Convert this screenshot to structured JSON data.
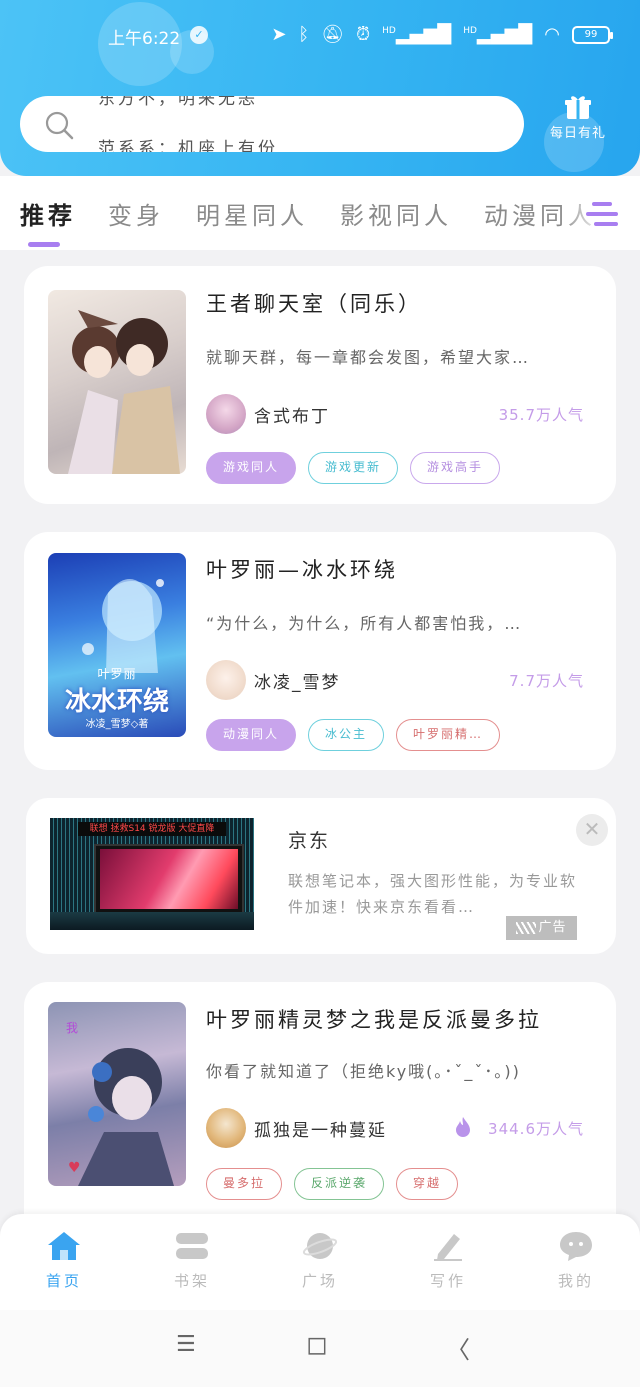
{
  "status_bar": {
    "time": "上午6:22",
    "battery": "99"
  },
  "search": {
    "hint_top": "东方不，明来无恙",
    "hint_bottom": "范系系：机座上有份"
  },
  "gift": {
    "label": "每日有礼"
  },
  "tabs": [
    {
      "label": "推荐"
    },
    {
      "label": "变身"
    },
    {
      "label": "明星同人"
    },
    {
      "label": "影视同人"
    },
    {
      "label": "动漫同人"
    }
  ],
  "books": [
    {
      "title": "王者聊天室（同乐）",
      "description": "就聊天群，每一章都会发图，希望大家…",
      "author": "含式布丁",
      "popularity": "35.7万人气",
      "tags": [
        "游戏同人",
        "游戏更新",
        "游戏高手"
      ]
    },
    {
      "title": "叶罗丽—冰水环绕",
      "description": "“为什么，为什么，所有人都害怕我，…",
      "author": "冰凌_雪梦",
      "popularity": "7.7万人气",
      "cover_text": {
        "series": "叶罗丽",
        "title": "冰水环绕",
        "author": "冰凌_雪梦◇著"
      },
      "tags": [
        "动漫同人",
        "冰公主",
        "叶罗丽精…"
      ]
    },
    {
      "title": "叶罗丽精灵梦之我是反派曼多拉",
      "description": "你看了就知道了（拒绝ky哦(｡･ˇ_ˇ･｡))",
      "author": "孤独是一种蔓延",
      "popularity": "344.6万人气",
      "tags": [
        "曼多拉",
        "反派逆袭",
        "穿越"
      ]
    }
  ],
  "ad": {
    "title": "京东",
    "description": "联想笔记本，强大图形性能，为专业软件加速！快来京东看看…",
    "badge": "广告",
    "banner_text": "联想 拯救S14 锐龙版 大促直降",
    "close": "✕"
  },
  "bottom_nav": [
    {
      "label": "首页",
      "active": true
    },
    {
      "label": "书架"
    },
    {
      "label": "广场"
    },
    {
      "label": "写作"
    },
    {
      "label": "我的"
    }
  ],
  "system_nav": {
    "menu": "☰",
    "home": "◻",
    "back": "〈"
  },
  "colors": {
    "header": "#35b4f2",
    "accent_purple": "#a87ef0",
    "nav_active": "#3aa4f0",
    "popularity": "#c49ce8"
  }
}
